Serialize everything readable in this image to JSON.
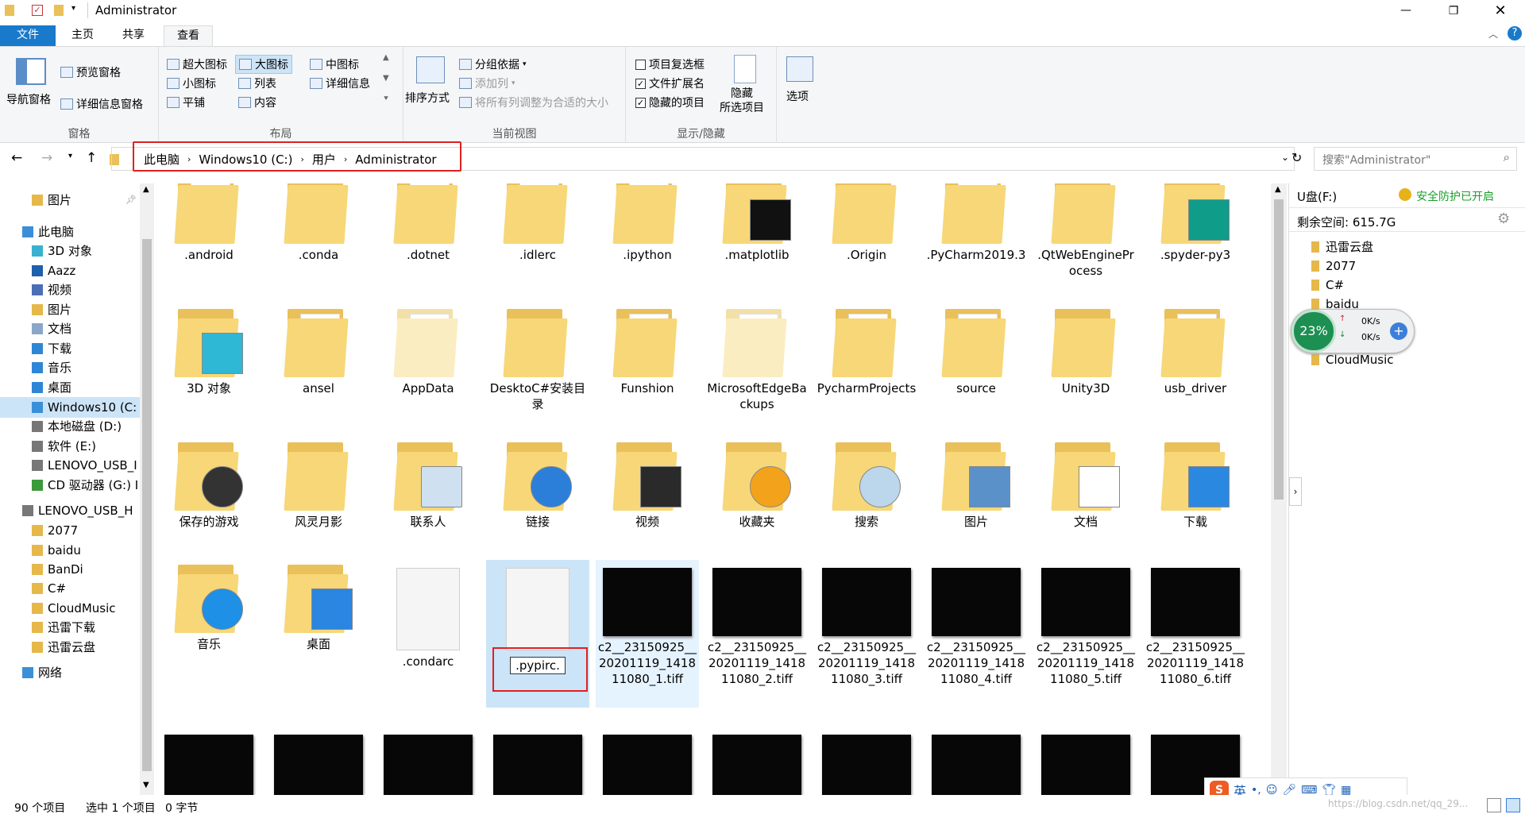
{
  "window": {
    "title": "Administrator"
  },
  "tabs": {
    "file": "文件",
    "home": "主页",
    "share": "共享",
    "view": "查看"
  },
  "ribbon": {
    "panes": {
      "nav": "导航窗格",
      "preview": "预览窗格",
      "details": "详细信息窗格",
      "label": "窗格"
    },
    "layout": {
      "xl": "超大图标",
      "large": "大图标",
      "medium": "中图标",
      "small": "小图标",
      "list": "列表",
      "details": "详细信息",
      "tiles": "平铺",
      "content": "内容",
      "label": "布局"
    },
    "current": {
      "sort": "排序方式",
      "group": "分组依据",
      "add_col": "添加列",
      "fit": "将所有列调整为合适的大小",
      "label": "当前视图"
    },
    "show": {
      "item_cb": "项目复选框",
      "ext": "文件扩展名",
      "hidden": "隐藏的项目",
      "hide_sel_1": "隐藏",
      "hide_sel_2": "所选项目",
      "label": "显示/隐藏"
    },
    "options": "选项"
  },
  "address": {
    "crumbs": [
      "此电脑",
      "Windows10 (C:)",
      "用户",
      "Administrator"
    ],
    "search_placeholder": "搜索\"Administrator\""
  },
  "nav": [
    {
      "label": "图片",
      "indent": 1,
      "color": "#e6b84a"
    },
    {
      "label": "此电脑",
      "indent": 0,
      "color": "#3b8fd9"
    },
    {
      "label": "3D 对象",
      "indent": 1,
      "color": "#3ab0d0"
    },
    {
      "label": "Aazz",
      "indent": 1,
      "color": "#1e5fae"
    },
    {
      "label": "视频",
      "indent": 1,
      "color": "#4a6fb5"
    },
    {
      "label": "图片",
      "indent": 1,
      "color": "#e6b84a"
    },
    {
      "label": "文档",
      "indent": 1,
      "color": "#8aa7c8"
    },
    {
      "label": "下载",
      "indent": 1,
      "color": "#2f86d6"
    },
    {
      "label": "音乐",
      "indent": 1,
      "color": "#2f86d6"
    },
    {
      "label": "桌面",
      "indent": 1,
      "color": "#2f86d6"
    },
    {
      "label": "Windows10 (C:",
      "indent": 1,
      "color": "#3b8fd9"
    },
    {
      "label": "本地磁盘 (D:)",
      "indent": 1,
      "color": "#777777"
    },
    {
      "label": "软件 (E:)",
      "indent": 1,
      "color": "#777777"
    },
    {
      "label": "LENOVO_USB_I",
      "indent": 1,
      "color": "#777777"
    },
    {
      "label": "CD 驱动器 (G:) I",
      "indent": 1,
      "color": "#3c9a3c"
    },
    {
      "label": "LENOVO_USB_H",
      "indent": 0,
      "color": "#777777"
    },
    {
      "label": "2077",
      "indent": 1,
      "color": "#e6b84a"
    },
    {
      "label": "baidu",
      "indent": 1,
      "color": "#e6b84a"
    },
    {
      "label": "BanDi",
      "indent": 1,
      "color": "#e6b84a"
    },
    {
      "label": "C#",
      "indent": 1,
      "color": "#e6b84a"
    },
    {
      "label": "CloudMusic",
      "indent": 1,
      "color": "#e6b84a"
    },
    {
      "label": "迅雷下载",
      "indent": 1,
      "color": "#e6b84a"
    },
    {
      "label": "迅雷云盘",
      "indent": 1,
      "color": "#e6b84a"
    },
    {
      "label": "网络",
      "indent": 0,
      "color": "#3b8fd9"
    }
  ],
  "files": [
    {
      "label": ".android",
      "kind": "folder-doc"
    },
    {
      "label": ".conda",
      "kind": "folder"
    },
    {
      "label": ".dotnet",
      "kind": "folder-doc"
    },
    {
      "label": ".idlerc",
      "kind": "folder-doc"
    },
    {
      "label": ".ipython",
      "kind": "folder-doc"
    },
    {
      "label": ".matplotlib",
      "kind": "folder-mpl"
    },
    {
      "label": ".Origin",
      "kind": "folder"
    },
    {
      "label": ".PyCharm2019.3",
      "kind": "folder-doc"
    },
    {
      "label": ".QtWebEngineProcess",
      "kind": "folder"
    },
    {
      "label": ".spyder-py3",
      "kind": "folder-pc"
    },
    {
      "label": "3D 对象",
      "kind": "folder-3d"
    },
    {
      "label": "ansel",
      "kind": "folder-doc"
    },
    {
      "label": "AppData",
      "kind": "folder-light"
    },
    {
      "label": "DesktoC#安装目录",
      "kind": "folder"
    },
    {
      "label": "Funshion",
      "kind": "folder-gear"
    },
    {
      "label": "MicrosoftEdgeBackups",
      "kind": "folder-light"
    },
    {
      "label": "PycharmProjects",
      "kind": "folder-doc"
    },
    {
      "label": "source",
      "kind": "folder-doc"
    },
    {
      "label": "Unity3D",
      "kind": "folder"
    },
    {
      "label": "usb_driver",
      "kind": "folder-doc"
    },
    {
      "label": "保存的游戏",
      "kind": "folder-game"
    },
    {
      "label": "风灵月影",
      "kind": "folder"
    },
    {
      "label": "联系人",
      "kind": "folder-contact"
    },
    {
      "label": "链接",
      "kind": "folder-link"
    },
    {
      "label": "视频",
      "kind": "folder-video"
    },
    {
      "label": "收藏夹",
      "kind": "folder-star"
    },
    {
      "label": "搜索",
      "kind": "folder-search"
    },
    {
      "label": "图片",
      "kind": "folder-pic"
    },
    {
      "label": "文档",
      "kind": "folder-docs"
    },
    {
      "label": "下载",
      "kind": "folder-down"
    },
    {
      "label": "音乐",
      "kind": "folder-music"
    },
    {
      "label": "桌面",
      "kind": "folder-desk"
    },
    {
      "label": ".condarc",
      "kind": "doc"
    },
    {
      "label": ".pypirc.",
      "kind": "doc-rename"
    },
    {
      "label": "c2__23150925__20201119_141811080_1.tiff",
      "kind": "thumb"
    },
    {
      "label": "c2__23150925__20201119_141811080_2.tiff",
      "kind": "thumb"
    },
    {
      "label": "c2__23150925__20201119_141811080_3.tiff",
      "kind": "thumb"
    },
    {
      "label": "c2__23150925__20201119_141811080_4.tiff",
      "kind": "thumb"
    },
    {
      "label": "c2__23150925__20201119_141811080_5.tiff",
      "kind": "thumb"
    },
    {
      "label": "c2__23150925__20201119_141811080_6.tiff",
      "kind": "thumb"
    },
    {
      "label": "",
      "kind": "thumb"
    },
    {
      "label": "",
      "kind": "thumb"
    },
    {
      "label": "",
      "kind": "thumb"
    },
    {
      "label": "",
      "kind": "thumb"
    },
    {
      "label": "",
      "kind": "thumb"
    },
    {
      "label": "",
      "kind": "thumb"
    },
    {
      "label": "",
      "kind": "thumb"
    },
    {
      "label": "",
      "kind": "thumb"
    },
    {
      "label": "",
      "kind": "thumb"
    },
    {
      "label": "",
      "kind": "thumb"
    }
  ],
  "right_pane": {
    "drive": "U盘(F:)",
    "protect": "安全防护已开启",
    "free": "剩余空间: 615.7G",
    "items": [
      "迅雷云盘",
      "2077",
      "C#",
      "baidu",
      "CloudMusic"
    ],
    "widget": {
      "percent": "23%",
      "up": "0K/s",
      "down": "0K/s"
    }
  },
  "ime": {
    "lang": "英",
    "punct": "•,"
  },
  "status": {
    "count": "90 个项目",
    "selected": "选中 1 个项目",
    "size": "0 字节"
  },
  "watermark": "https://blog.csdn.net/qq_29..."
}
